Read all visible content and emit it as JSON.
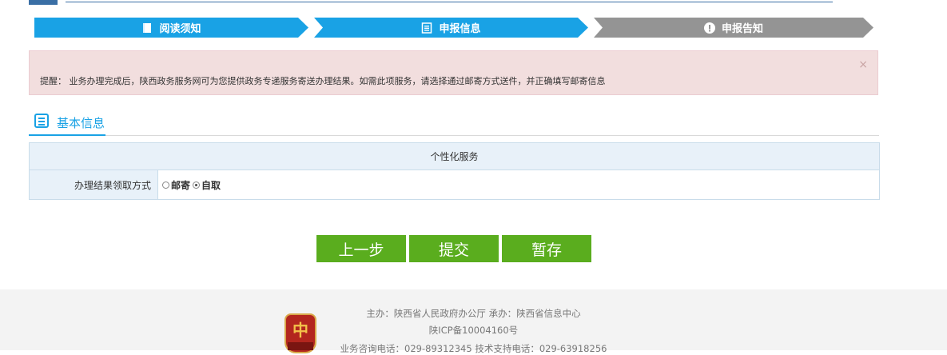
{
  "steps": [
    {
      "label": "阅读须知",
      "icon": "book-icon"
    },
    {
      "label": "申报信息",
      "icon": "form-list-icon"
    },
    {
      "label": "申报告知",
      "icon": "exclamation-circle-icon"
    }
  ],
  "colors": {
    "step_active": "#19a2e5",
    "step_inactive": "#949494",
    "button": "#5aad1e",
    "alert_bg": "#f2dede"
  },
  "alert": {
    "text": "提醒：  业务办理完成后，陕西政务服务网可为您提供政务专递服务寄送办理结果。如需此项服务，请选择通过邮寄方式送件，并正确填写邮寄信息",
    "close": "×"
  },
  "section": {
    "title": "基本信息"
  },
  "table": {
    "header": "个性化服务",
    "row_label": "办理结果领取方式",
    "options": [
      {
        "label": "邮寄",
        "selected": false
      },
      {
        "label": "自取",
        "selected": true
      }
    ]
  },
  "buttons": {
    "prev": "上一步",
    "submit": "提交",
    "save": "暂存"
  },
  "footer": {
    "line1": "主办：陕西省人民政府办公厅    承办：陕西省信息中心",
    "line2": "陕ICP备10004160号",
    "line3": "业务咨询电话：029-89312345    技术支持电话：029-63918256"
  }
}
